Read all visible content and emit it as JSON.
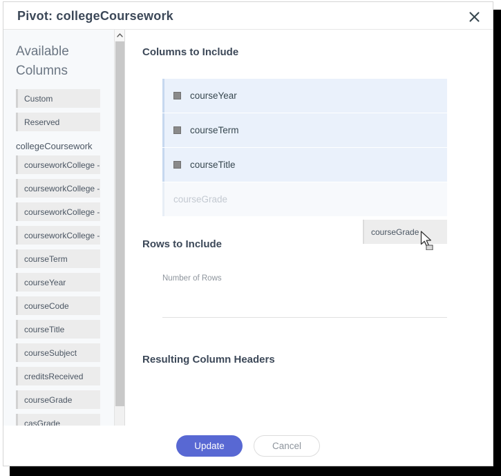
{
  "window": {
    "title": "Pivot: collegeCoursework",
    "close_icon": "close-icon"
  },
  "sidebar": {
    "heading": "Available Columns",
    "scroll_up_icon": "chevron-up-icon",
    "top_chips": [
      {
        "label": "Custom"
      },
      {
        "label": "Reserved"
      }
    ],
    "group_label": "collegeCoursework",
    "chips": [
      {
        "label": "courseworkCollege - C..."
      },
      {
        "label": "courseworkCollege - N..."
      },
      {
        "label": "courseworkCollege - P..."
      },
      {
        "label": "courseworkCollege - C..."
      },
      {
        "label": "courseTerm"
      },
      {
        "label": "courseYear"
      },
      {
        "label": "courseCode"
      },
      {
        "label": "courseTitle"
      },
      {
        "label": "courseSubject"
      },
      {
        "label": "creditsReceived"
      },
      {
        "label": "courseGrade"
      },
      {
        "label": "casGrade"
      },
      {
        "label": ""
      }
    ]
  },
  "main": {
    "columns_section": {
      "title": "Columns to Include",
      "items": [
        {
          "label": "courseYear",
          "handle_icon": "drag-handle-icon",
          "state": "normal"
        },
        {
          "label": "courseTerm",
          "handle_icon": "drag-handle-icon",
          "state": "normal"
        },
        {
          "label": "courseTitle",
          "handle_icon": "drag-handle-icon",
          "state": "normal"
        },
        {
          "label": "courseGrade",
          "handle_icon": "drag-handle-icon",
          "state": "dragging"
        }
      ],
      "drag_ghost_label": "courseGrade"
    },
    "rows_section": {
      "title": "Rows to Include",
      "field_label": "Number of Rows",
      "field_value": "",
      "field_placeholder": ""
    },
    "headers_section": {
      "title": "Resulting Column Headers"
    }
  },
  "footer": {
    "update_label": "Update",
    "cancel_label": "Cancel"
  },
  "colors": {
    "primary": "#5868d3",
    "row_bg": "#eaf1fb",
    "row_accent": "#c6d8ef",
    "chip_bg": "#ececec",
    "title_text": "#3c4858"
  }
}
